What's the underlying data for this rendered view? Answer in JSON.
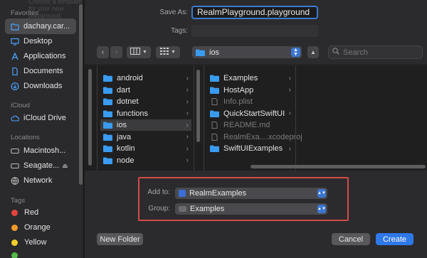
{
  "background_text": "Choose a template for your new playground:",
  "sidebar": {
    "favorites_heading": "Favorites",
    "favorites": [
      {
        "label": "dachary.car...",
        "icon": "home-folder-icon",
        "selected": true
      },
      {
        "label": "Desktop",
        "icon": "desktop-icon"
      },
      {
        "label": "Applications",
        "icon": "applications-icon"
      },
      {
        "label": "Documents",
        "icon": "document-icon"
      },
      {
        "label": "Downloads",
        "icon": "download-icon"
      }
    ],
    "icloud_heading": "iCloud",
    "icloud": [
      {
        "label": "iCloud Drive",
        "icon": "icloud-icon"
      }
    ],
    "locations_heading": "Locations",
    "locations": [
      {
        "label": "Macintosh...",
        "icon": "hard-drive-icon"
      },
      {
        "label": "Seagate...",
        "icon": "external-drive-icon"
      },
      {
        "label": "Network",
        "icon": "network-icon"
      }
    ],
    "tags_heading": "Tags",
    "tags": [
      {
        "label": "Red",
        "color": "#e5443c"
      },
      {
        "label": "Orange",
        "color": "#f39b2a"
      },
      {
        "label": "Yellow",
        "color": "#f4d02b"
      }
    ]
  },
  "form": {
    "save_as_label": "Save As:",
    "save_as_value": "RealmPlayground.playground",
    "tags_label": "Tags:"
  },
  "toolbar": {
    "location": "ios",
    "search_placeholder": "Search"
  },
  "columns": {
    "col1": [
      "android",
      "dart",
      "dotnet",
      "functions",
      "ios",
      "java",
      "kotlin",
      "node"
    ],
    "col1_selected": "ios",
    "col2": [
      {
        "label": "Examples",
        "type": "folder",
        "chevron": true
      },
      {
        "label": "HostApp",
        "type": "folder",
        "chevron": true
      },
      {
        "label": "Info.plist",
        "type": "file",
        "dim": true
      },
      {
        "label": "QuickStartSwiftUI",
        "type": "folder",
        "chevron": true
      },
      {
        "label": "README.md",
        "type": "file",
        "dim": true
      },
      {
        "label": "RealmExa....xcodeproj",
        "type": "file",
        "dim": true
      },
      {
        "label": "SwiftUIExamples",
        "type": "folder",
        "chevron": true
      }
    ]
  },
  "options": {
    "add_to_label": "Add to:",
    "add_to_value": "RealmExamples",
    "group_label": "Group:",
    "group_value": "Examples"
  },
  "buttons": {
    "new_folder": "New Folder",
    "cancel": "Cancel",
    "create": "Create"
  },
  "colors": {
    "accent": "#2f78e8",
    "folder": "#3a9bf0",
    "highlight_box": "#d24b46"
  }
}
